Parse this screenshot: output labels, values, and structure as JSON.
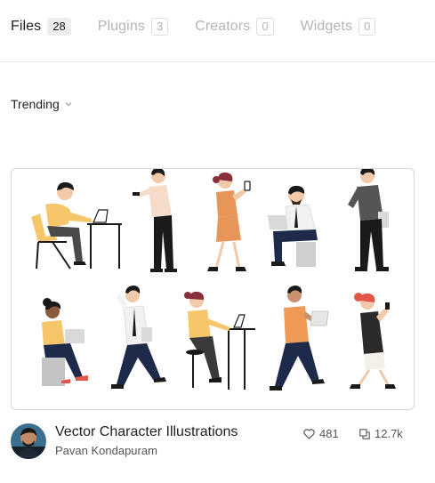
{
  "tabs": [
    {
      "label": "Files",
      "count": "28",
      "active": true
    },
    {
      "label": "Plugins",
      "count": "3",
      "active": false
    },
    {
      "label": "Creators",
      "count": "0",
      "active": false
    },
    {
      "label": "Widgets",
      "count": "0",
      "active": false
    }
  ],
  "sort": {
    "label": "Trending",
    "icon": "chevron-down-icon"
  },
  "card": {
    "title": "Vector Character Illustrations",
    "author": "Pavan Kondapuram",
    "likes": "481",
    "duplicates": "12.7k",
    "like_icon": "heart-icon",
    "duplicate_icon": "duplicate-icon"
  },
  "colors": {
    "text_primary": "#1f1f1f",
    "text_muted": "#b5b5b5",
    "border": "#d6d6d6",
    "shirt_yellow": "#f5c76a",
    "skirt_orange": "#e8955a",
    "shirt_orange": "#ef9a55",
    "pants_navy": "#1e2a4a",
    "hair_dark": "#1a1a1a",
    "hair_red": "#e2564a",
    "skin": "#f2c9a9",
    "skin_dark": "#8a5a3c"
  }
}
